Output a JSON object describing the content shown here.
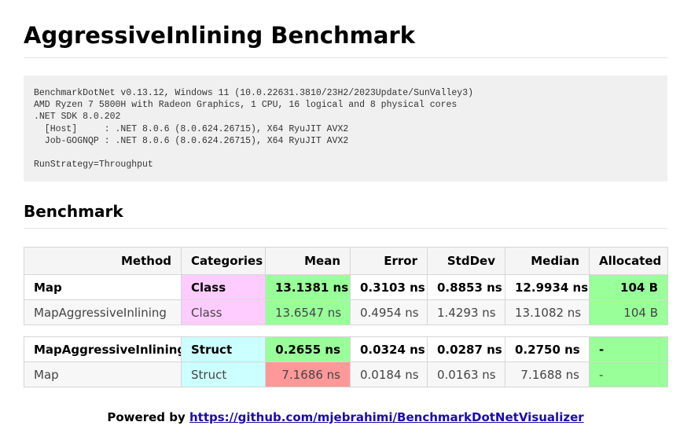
{
  "page": {
    "title": "AggressiveInlining Benchmark"
  },
  "environment": {
    "lines": [
      "BenchmarkDotNet v0.13.12, Windows 11 (10.0.22631.3810/23H2/2023Update/SunValley3)",
      "AMD Ryzen 7 5800H with Radeon Graphics, 1 CPU, 16 logical and 8 physical cores",
      ".NET SDK 8.0.202",
      "  [Host]     : .NET 8.0.6 (8.0.624.26715), X64 RyuJIT AVX2",
      "  Job-GOGNQP : .NET 8.0.6 (8.0.624.26715), X64 RyuJIT AVX2",
      "",
      "RunStrategy=Throughput"
    ]
  },
  "section": {
    "title": "Benchmark"
  },
  "colors": {
    "class_bg": "#ffccff",
    "struct_bg": "#ccffff",
    "best_bg": "#99ff99",
    "worst_bg": "#ff9999",
    "plain_bg": "#ffffff",
    "alt_bg": "#f7f7f7"
  },
  "table": {
    "headers": [
      "Method",
      "Categories",
      "Mean",
      "Error",
      "StdDev",
      "Median",
      "Allocated"
    ],
    "groups": [
      {
        "rows": [
          {
            "method": "Map",
            "category": "Class",
            "mean": "13.1381 ns",
            "error": "0.3103 ns",
            "stddev": "0.8853 ns",
            "median": "12.9934 ns",
            "allocated": "104 B",
            "style": "bold",
            "mean_highlight": "best",
            "allocated_highlight": "best"
          },
          {
            "method": "MapAggressiveInlining",
            "category": "Class",
            "mean": "13.6547 ns",
            "error": "0.4954 ns",
            "stddev": "1.4293 ns",
            "median": "13.1082 ns",
            "allocated": "104 B",
            "style": "alt",
            "mean_highlight": "best",
            "allocated_highlight": "best"
          }
        ]
      },
      {
        "rows": [
          {
            "method": "MapAggressiveInlining",
            "category": "Struct",
            "mean": "0.2655 ns",
            "error": "0.0324 ns",
            "stddev": "0.0287 ns",
            "median": "0.2750 ns",
            "allocated": "-",
            "style": "bold",
            "mean_highlight": "best",
            "allocated_highlight": "best"
          },
          {
            "method": "Map",
            "category": "Struct",
            "mean": "7.1686 ns",
            "error": "0.0184 ns",
            "stddev": "0.0163 ns",
            "median": "7.1688 ns",
            "allocated": "-",
            "style": "alt",
            "mean_highlight": "worst",
            "allocated_highlight": "best"
          }
        ]
      }
    ]
  },
  "footer": {
    "prefix": "Powered by ",
    "link_text": "https://github.com/mjebrahimi/BenchmarkDotNetVisualizer"
  }
}
